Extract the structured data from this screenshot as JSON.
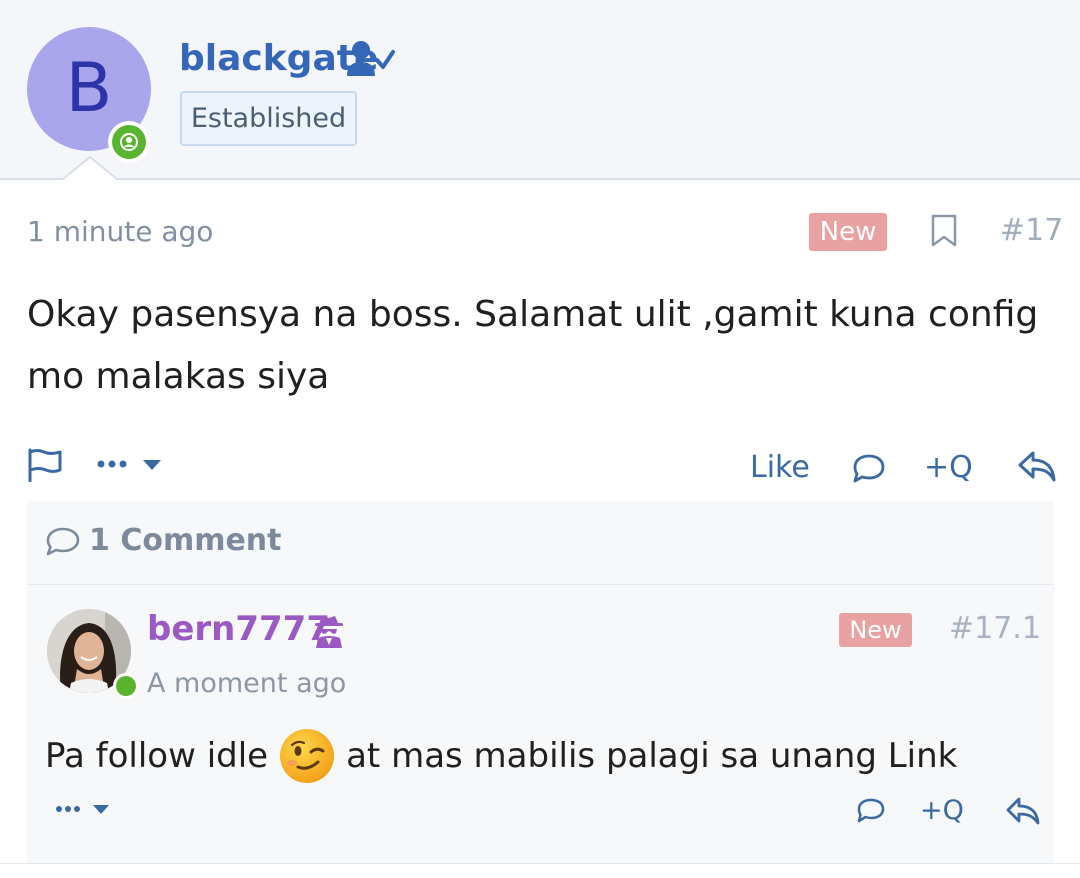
{
  "header": {
    "avatar_letter": "B",
    "username": "blackgate",
    "rank": "Established"
  },
  "post": {
    "time": "1 minute ago",
    "badge": "New",
    "number": "#17",
    "body": "Okay pasensya na boss. Salamat ulit ,gamit kuna config mo malakas siya",
    "actions": {
      "like": "Like",
      "quote": "+Q"
    }
  },
  "comments": {
    "heading": "1 Comment",
    "items": [
      {
        "username": "bern7777",
        "time": "A moment ago",
        "badge": "New",
        "number": "#17.1",
        "body_before": "Pa follow idle",
        "body_after": "at mas mabilis palagi sa unang Link",
        "quote": "+Q"
      }
    ]
  },
  "colors": {
    "link_blue": "#3467b8",
    "online_green": "#59b52f",
    "new_badge": "#e8a2a2",
    "username_purple": "#9b59c3"
  },
  "icons": [
    "verified-user-icon",
    "online-user-icon",
    "bookmark-icon",
    "flag-icon",
    "more-icon",
    "chevron-down-icon",
    "comment-icon",
    "reply-icon",
    "spy-icon",
    "wink-emoji-icon"
  ]
}
